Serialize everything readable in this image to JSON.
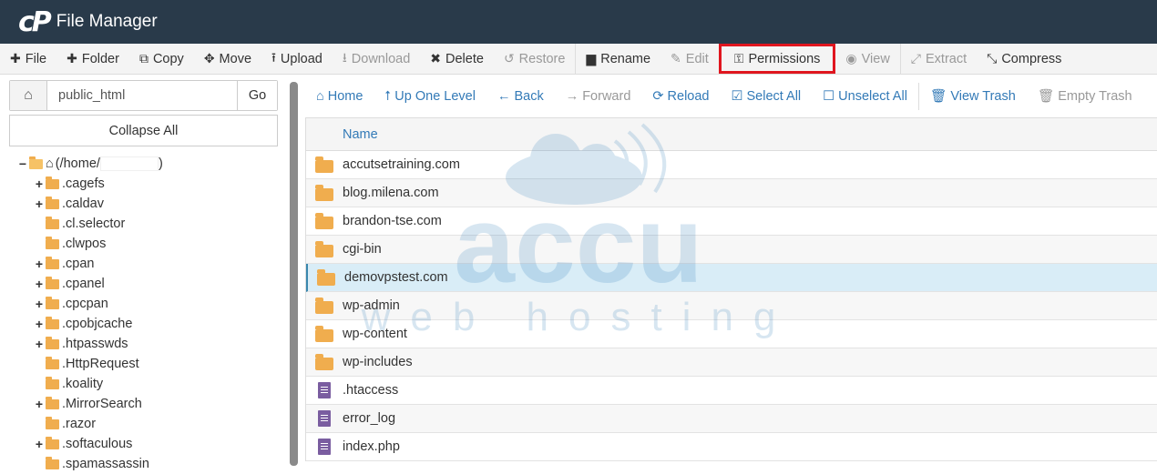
{
  "header": {
    "logo": "cP",
    "title": "File Manager"
  },
  "toolbar": [
    {
      "icon": "plus-icon",
      "glyph": "✚",
      "label": "File",
      "enabled": true
    },
    {
      "icon": "plus-icon",
      "glyph": "✚",
      "label": "Folder",
      "enabled": true
    },
    {
      "icon": "copy-icon",
      "glyph": "⧉",
      "label": "Copy",
      "enabled": true
    },
    {
      "icon": "move-icon",
      "glyph": "✥",
      "label": "Move",
      "enabled": true
    },
    {
      "icon": "upload-icon",
      "glyph": "⭱",
      "label": "Upload",
      "enabled": true
    },
    {
      "icon": "download-icon",
      "glyph": "⭳",
      "label": "Download",
      "enabled": false
    },
    {
      "icon": "delete-icon",
      "glyph": "✖",
      "label": "Delete",
      "enabled": true
    },
    {
      "icon": "restore-icon",
      "glyph": "↺",
      "label": "Restore",
      "enabled": false
    },
    {
      "icon": "rename-icon",
      "glyph": "▆",
      "label": "Rename",
      "enabled": true
    },
    {
      "icon": "edit-icon",
      "glyph": "✎",
      "label": "Edit",
      "enabled": false
    },
    {
      "icon": "key-icon",
      "glyph": "⚿",
      "label": "Permissions",
      "enabled": true,
      "highlighted": true
    },
    {
      "icon": "eye-icon",
      "glyph": "◉",
      "label": "View",
      "enabled": false
    },
    {
      "icon": "expand-icon",
      "glyph": "⤢",
      "label": "Extract",
      "enabled": false
    },
    {
      "icon": "compress-icon",
      "glyph": "⤡",
      "label": "Compress",
      "enabled": true
    }
  ],
  "path": {
    "value": "public_html",
    "go": "Go"
  },
  "collapse_label": "Collapse All",
  "tree": {
    "root_prefix": "(/home/",
    "root_suffix": ")",
    "items": [
      {
        "label": ".cagefs",
        "expandable": true
      },
      {
        "label": ".caldav",
        "expandable": true
      },
      {
        "label": ".cl.selector",
        "expandable": false
      },
      {
        "label": ".clwpos",
        "expandable": false
      },
      {
        "label": ".cpan",
        "expandable": true
      },
      {
        "label": ".cpanel",
        "expandable": true
      },
      {
        "label": ".cpcpan",
        "expandable": true
      },
      {
        "label": ".cpobjcache",
        "expandable": true
      },
      {
        "label": ".htpasswds",
        "expandable": true
      },
      {
        "label": ".HttpRequest",
        "expandable": false
      },
      {
        "label": ".koality",
        "expandable": false
      },
      {
        "label": ".MirrorSearch",
        "expandable": true
      },
      {
        "label": ".razor",
        "expandable": false
      },
      {
        "label": ".softaculous",
        "expandable": true
      },
      {
        "label": ".spamassassin",
        "expandable": false
      }
    ]
  },
  "nav": [
    {
      "icon": "home-icon",
      "glyph": "⌂",
      "label": "Home",
      "enabled": true
    },
    {
      "icon": "level-up-icon",
      "glyph": "⭡",
      "label": "Up One Level",
      "enabled": true
    },
    {
      "icon": "arrow-left-icon",
      "glyph": "←",
      "label": "Back",
      "enabled": true
    },
    {
      "icon": "arrow-right-icon",
      "glyph": "→",
      "label": "Forward",
      "enabled": false
    },
    {
      "icon": "reload-icon",
      "glyph": "⟳",
      "label": "Reload",
      "enabled": true
    },
    {
      "icon": "check-square-icon",
      "glyph": "☑",
      "label": "Select All",
      "enabled": true
    },
    {
      "icon": "square-icon",
      "glyph": "☐",
      "label": "Unselect All",
      "enabled": true
    },
    {
      "icon": "trash-icon",
      "glyph": "🗑",
      "label": "View Trash",
      "enabled": true
    },
    {
      "icon": "trash-icon",
      "glyph": "🗑",
      "label": "Empty Trash",
      "enabled": false
    }
  ],
  "table": {
    "header": "Name",
    "rows": [
      {
        "name": "accutsetraining.com",
        "type": "folder"
      },
      {
        "name": "blog.milena.com",
        "type": "folder"
      },
      {
        "name": "brandon-tse.com",
        "type": "folder"
      },
      {
        "name": "cgi-bin",
        "type": "folder"
      },
      {
        "name": "demovpstest.com",
        "type": "folder",
        "selected": true
      },
      {
        "name": "wp-admin",
        "type": "folder"
      },
      {
        "name": "wp-content",
        "type": "folder"
      },
      {
        "name": "wp-includes",
        "type": "folder"
      },
      {
        "name": ".htaccess",
        "type": "file"
      },
      {
        "name": "error_log",
        "type": "file"
      },
      {
        "name": "index.php",
        "type": "file"
      }
    ]
  },
  "watermark": {
    "word1": "accu",
    "word2": "web hosting"
  },
  "colors": {
    "header": "#293a4a",
    "link": "#337ab7",
    "folder": "#f0ad4e",
    "highlight": "#e0161f",
    "selected_row": "#d9edf7"
  }
}
